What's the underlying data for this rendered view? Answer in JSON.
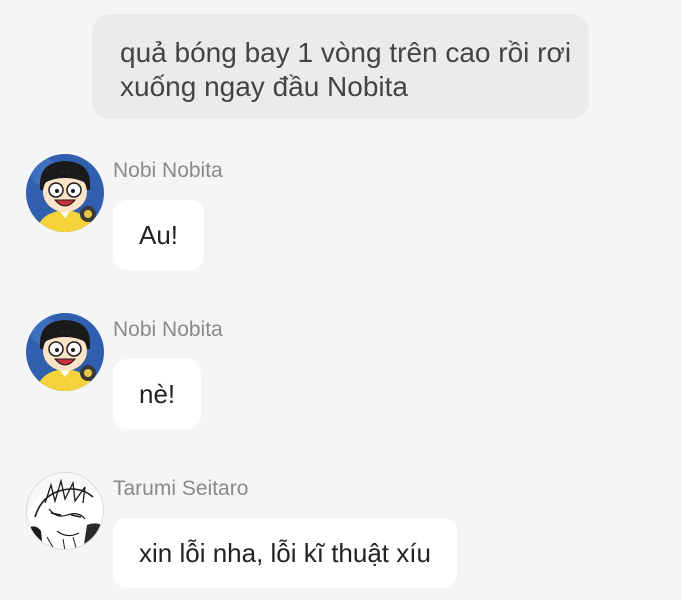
{
  "system_message": {
    "line1": "quả bóng bay 1 vòng trên cao rồi rơi",
    "line2": "xuống ngay đầu Nobita"
  },
  "messages": [
    {
      "sender": "Nobi Nobita",
      "text": "Au!",
      "avatar_icon": "nobita-avatar-icon"
    },
    {
      "sender": "Nobi Nobita",
      "text": "nè!",
      "avatar_icon": "nobita-avatar-icon"
    },
    {
      "sender": "Tarumi Seitaro",
      "text": "xin lỗi nha, lỗi kĩ thuật xíu",
      "avatar_icon": "tarumi-avatar-icon"
    }
  ],
  "colors": {
    "page_background": "#f4f5f7",
    "system_bubble": "#ebebeb",
    "chat_bubble": "#ffffff",
    "sender_name": "#8a8a8a",
    "nobita_avatar_bg": "#2f5fae",
    "nobita_shirt": "#f4d33a"
  }
}
